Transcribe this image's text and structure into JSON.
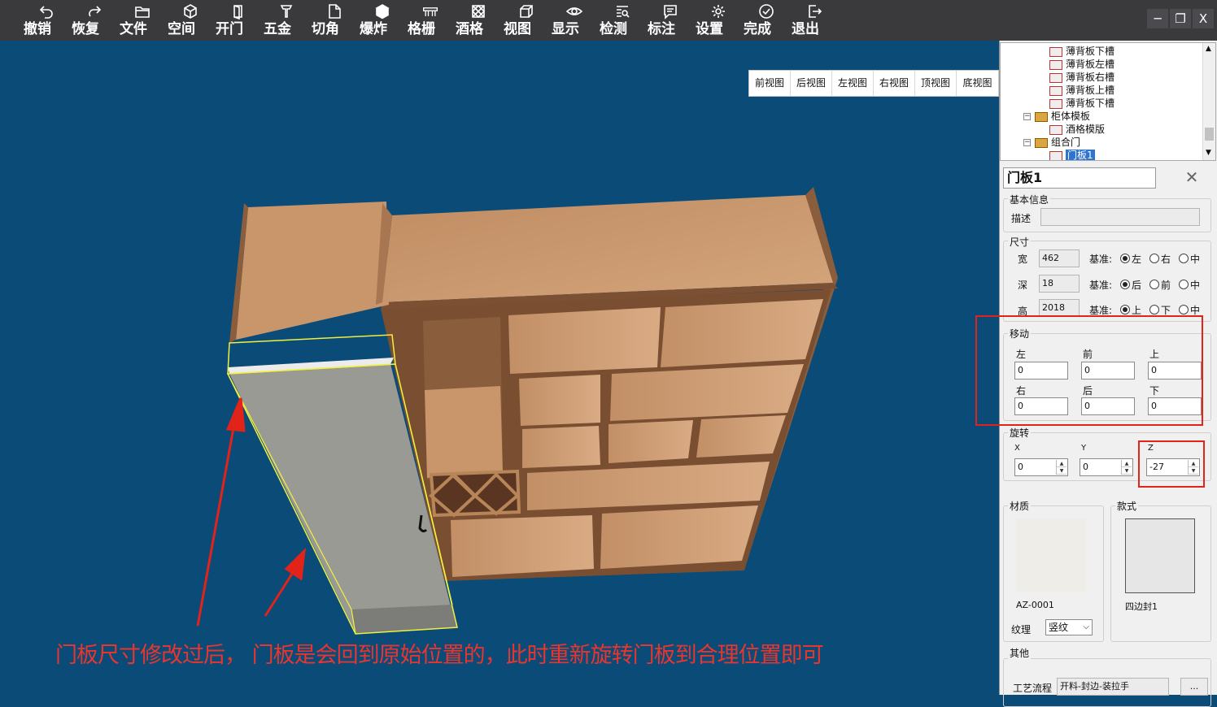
{
  "toolbar": {
    "buttons": [
      {
        "label": "撤销",
        "icon": "undo-icon"
      },
      {
        "label": "恢复",
        "icon": "redo-icon"
      },
      {
        "label": "文件",
        "icon": "folder-icon"
      },
      {
        "label": "空间",
        "icon": "cube-outline-icon"
      },
      {
        "label": "开门",
        "icon": "door-icon"
      },
      {
        "label": "五金",
        "icon": "hardware-icon"
      },
      {
        "label": "切角",
        "icon": "cut-corner-icon"
      },
      {
        "label": "爆炸",
        "icon": "explode-cube-icon"
      },
      {
        "label": "格栅",
        "icon": "grille-icon"
      },
      {
        "label": "酒格",
        "icon": "wine-rack-icon"
      },
      {
        "label": "视图",
        "icon": "view-cube-icon"
      },
      {
        "label": "显示",
        "icon": "eye-icon"
      },
      {
        "label": "检测",
        "icon": "inspect-icon"
      },
      {
        "label": "标注",
        "icon": "annotation-icon"
      },
      {
        "label": "设置",
        "icon": "gear-icon"
      },
      {
        "label": "完成",
        "icon": "check-circle-icon"
      },
      {
        "label": "退出",
        "icon": "exit-icon"
      }
    ],
    "window_controls": [
      "─",
      "❐",
      "X"
    ]
  },
  "viewbar": [
    "前视图",
    "后视图",
    "左视图",
    "右视图",
    "顶视图",
    "底视图"
  ],
  "annotation_caption": "门板尺寸修改过后， 门板是会回到原始位置的，此时重新旋转门板到合理位置即可",
  "tree": {
    "items": [
      {
        "label": "薄背板下槽",
        "type": "panel"
      },
      {
        "label": "薄背板左槽",
        "type": "panel"
      },
      {
        "label": "薄背板右槽",
        "type": "panel"
      },
      {
        "label": "薄背板上槽",
        "type": "panel"
      },
      {
        "label": "薄背板下槽",
        "type": "panel"
      },
      {
        "label": "柜体模板",
        "type": "group"
      },
      {
        "label": "酒格模版",
        "type": "panel"
      },
      {
        "label": "组合门",
        "type": "group"
      },
      {
        "label": "门板1",
        "type": "panel",
        "selected": true
      }
    ]
  },
  "props": {
    "title": "门板1",
    "basic_info": "基本信息",
    "desc_label": "描述",
    "desc_value": "",
    "size_group": "尺寸",
    "width_label": "宽",
    "width_value": "462",
    "depth_label": "深",
    "depth_value": "18",
    "height_label": "高",
    "height_value": "2018",
    "base_label": "基准:",
    "width_base": [
      "左",
      "右",
      "中"
    ],
    "depth_base": [
      "后",
      "前",
      "中"
    ],
    "height_base": [
      "上",
      "下",
      "中"
    ],
    "move_group": "移动",
    "move": {
      "left_label": "左",
      "left": "0",
      "front_label": "前",
      "front": "0",
      "up_label": "上",
      "up": "0",
      "right_label": "右",
      "right": "0",
      "back_label": "后",
      "back": "0",
      "down_label": "下",
      "down": "0"
    },
    "rotate_group": "旋转",
    "rotate": {
      "x_label": "X",
      "x": "0",
      "y_label": "Y",
      "y": "0",
      "z_label": "Z",
      "z": "-27"
    },
    "material_label": "材质",
    "material_code": "AZ-0001",
    "style_label": "款式",
    "style_name": "四边封1",
    "grain_label": "纹理",
    "grain_value": "竖纹",
    "other_group": "其他",
    "process_label": "工艺流程",
    "process_value": "开料-封边-装拉手",
    "process_btn": "..."
  },
  "colors": {
    "toolbar_bg": "#3a3a3d",
    "viewport_bg": "#0a4b78",
    "highlight_red": "#e2231a",
    "wood_light": "#c9956a",
    "wood_dark": "#8a5e3c",
    "door_gray": "#9a9a94",
    "selection_yellow": "#f0f040"
  }
}
